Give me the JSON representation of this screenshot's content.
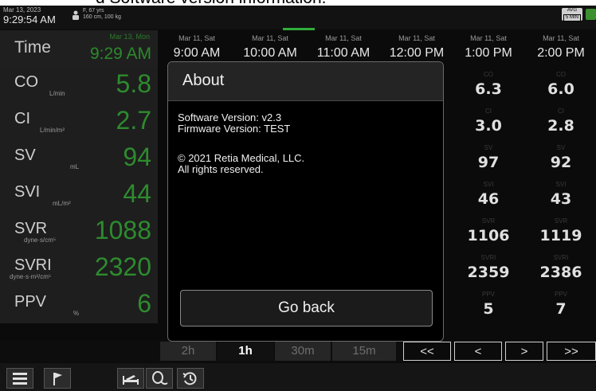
{
  "caption": "d Software version information.",
  "status": {
    "date": "Mar 13, 2023",
    "time": "9:29:54 AM",
    "patient_line1": "F, 67 yrs",
    "patient_line2": "160 cm, 100 kg",
    "avg_label": "AVG",
    "avg_window": "5 MIN"
  },
  "header": {
    "time_label": "Time",
    "current_date": "Mar 13, Mon",
    "current_time": "9:29 AM",
    "columns": [
      {
        "date": "Mar 11, Sat",
        "time": "9:00 AM"
      },
      {
        "date": "Mar 11, Sat",
        "time": "10:00 AM"
      },
      {
        "date": "Mar 11, Sat",
        "time": "11:00 AM"
      },
      {
        "date": "Mar 11, Sat",
        "time": "12:00 PM"
      },
      {
        "date": "Mar 11, Sat",
        "time": "1:00 PM"
      },
      {
        "date": "Mar 11, Sat",
        "time": "2:00 PM"
      }
    ]
  },
  "params": [
    {
      "name": "CO",
      "unit": "L/min",
      "value": "5.8",
      "hist": [
        "6.3",
        "6.0"
      ]
    },
    {
      "name": "CI",
      "unit": "L/min/m²",
      "value": "2.7",
      "hist": [
        "3.0",
        "2.8"
      ]
    },
    {
      "name": "SV",
      "unit": "mL",
      "value": "94",
      "hist": [
        "97",
        "92"
      ]
    },
    {
      "name": "SVI",
      "unit": "mL/m²",
      "value": "44",
      "hist": [
        "46",
        "43"
      ]
    },
    {
      "name": "SVR",
      "unit": "dyne·s/cm⁵",
      "value": "1088",
      "hist": [
        "1106",
        "1119"
      ]
    },
    {
      "name": "SVRI",
      "unit": "dyne·s·m²/cm⁵",
      "value": "2320",
      "hist": [
        "2359",
        "2386"
      ]
    },
    {
      "name": "PPV",
      "unit": "%",
      "value": "6",
      "hist": [
        "5",
        "7"
      ]
    }
  ],
  "range": {
    "options": [
      "2h",
      "1h",
      "30m",
      "15m"
    ],
    "selected": "1h",
    "nav": [
      "<<",
      "<",
      ">",
      ">>"
    ]
  },
  "dialog": {
    "title": "About",
    "software_version": "Software Version: v2.3",
    "firmware_version": "Firmware Version: TEST",
    "copyright": "© 2021 Retia Medical, LLC.",
    "rights": "All rights reserved.",
    "button": "Go back"
  },
  "colors": {
    "accent_green": "#2e8b2e",
    "background": "#0b0b0b"
  }
}
